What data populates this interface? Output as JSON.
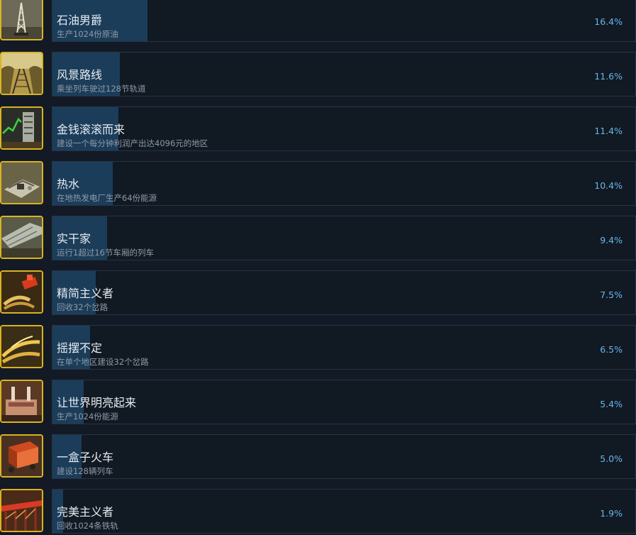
{
  "achievements": [
    {
      "name": "石油男爵",
      "description": "生产1024份原油",
      "percent_text": "16.4%",
      "percent": 16.4,
      "icon": "oil-derrick-icon"
    },
    {
      "name": "风景路线",
      "description": "乘坐列车驶过128节轨道",
      "percent_text": "11.6%",
      "percent": 11.6,
      "icon": "railway-tracks-icon"
    },
    {
      "name": "金钱滚滚而来",
      "description": "建设一个每分钟利润产出达4096元的地区",
      "percent_text": "11.4%",
      "percent": 11.4,
      "icon": "skyscraper-graph-icon"
    },
    {
      "name": "热水",
      "description": "在地热发电厂生产64份能源",
      "percent_text": "10.4%",
      "percent": 10.4,
      "icon": "geothermal-plant-icon"
    },
    {
      "name": "实干家",
      "description": "运行1超过16节车厢的列车",
      "percent_text": "9.4%",
      "percent": 9.4,
      "icon": "long-train-icon"
    },
    {
      "name": "精简主义者",
      "description": "回收32个岔路",
      "percent_text": "7.5%",
      "percent": 7.5,
      "icon": "recycle-switch-icon"
    },
    {
      "name": "摇摆不定",
      "description": "在单个地区建设32个岔路",
      "percent_text": "6.5%",
      "percent": 6.5,
      "icon": "rail-switch-icon"
    },
    {
      "name": "让世界明亮起来",
      "description": "生产1024份能源",
      "percent_text": "5.4%",
      "percent": 5.4,
      "icon": "power-plant-icon"
    },
    {
      "name": "一盒子火车",
      "description": "建设128辆列车",
      "percent_text": "5.0%",
      "percent": 5.0,
      "icon": "train-box-icon"
    },
    {
      "name": "完美主义者",
      "description": "回收1024条铁轨",
      "percent_text": "1.9%",
      "percent": 1.9,
      "icon": "bridge-rails-icon"
    }
  ],
  "colors": {
    "background": "#131a25",
    "progress_fill": "#1b3d5a",
    "percent_text": "#67b6ea",
    "icon_border": "#d9b322"
  }
}
